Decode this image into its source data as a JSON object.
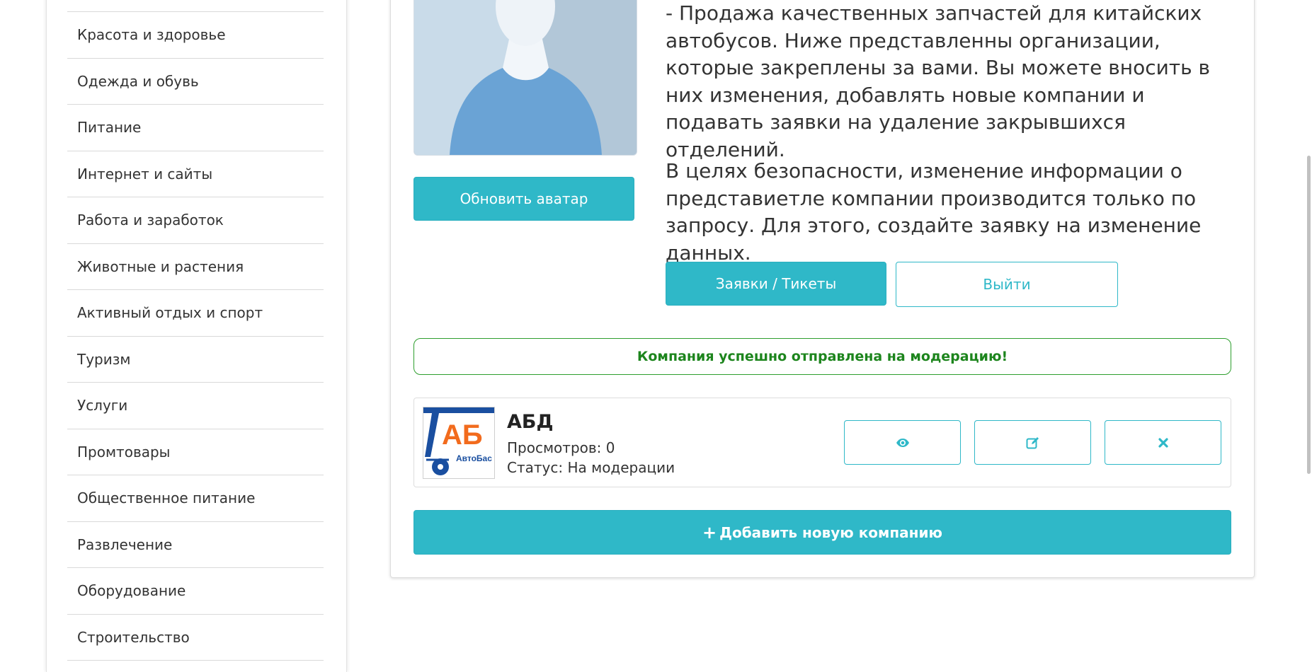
{
  "sidebar": {
    "categories": [
      "Красота и здоровье",
      "Одежда и обувь",
      "Питание",
      "Интернет и сайты",
      "Работа и заработок",
      "Животные и растения",
      "Активный отдых и спорт",
      "Туризм",
      "Услуги",
      "Промтовары",
      "Общественное питание",
      "Развлечение",
      "Оборудование",
      "Строительство"
    ]
  },
  "profile": {
    "update_avatar_label": "Обновить аватар",
    "description": "- Продажа качественных запчастей для китайских автобусов. Ниже представленны организации, которые закреплены за вами. Вы можете вносить в них изменения, добавлять новые компании и подавать заявки на удаление закрывшихся отделений.",
    "security_note": "В целях безопасности, изменение информации о представиетле компании производится только по запросу. Для этого, создайте заявку на изменение данных.",
    "tickets_label": "Заявки / Тикеты",
    "logout_label": "Выйти"
  },
  "alert": {
    "message": "Компания успешно отправлена на модерацию!"
  },
  "company": {
    "name": "АБД",
    "logo_text": "АБ",
    "logo_subtext": "АвтоБас",
    "views": "Просмотров: 0",
    "status": "Статус: На модерации",
    "view_icon": "eye-icon",
    "edit_icon": "edit-icon",
    "delete_icon": "close-icon"
  },
  "add_company": {
    "plus_glyph": "+",
    "label": "Добавить новую компанию"
  },
  "colors": {
    "accent": "#2fb8c8",
    "success": "#1d851d",
    "logo_orange": "#f26b1d",
    "logo_blue": "#1a4fa0"
  }
}
